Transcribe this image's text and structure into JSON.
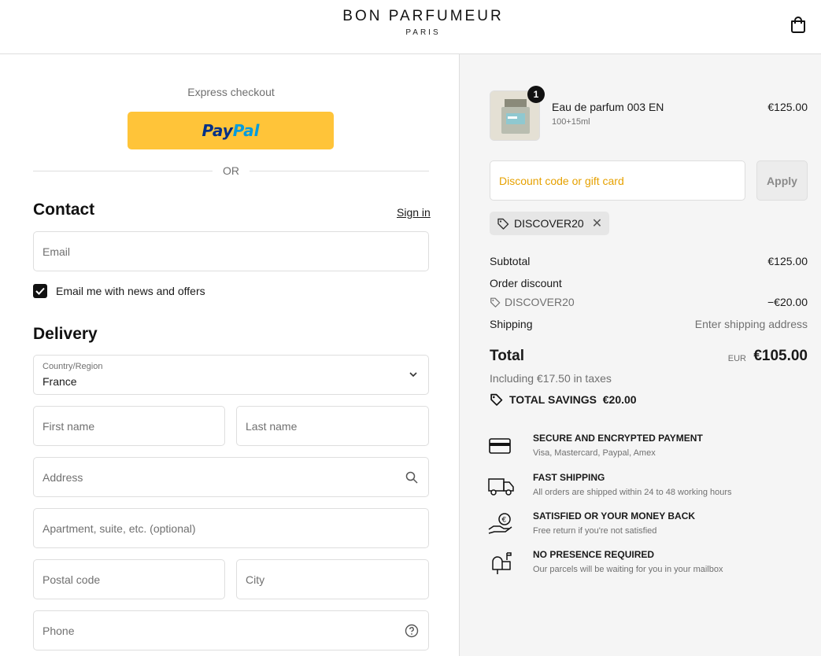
{
  "header": {
    "brand_name": "BON PARFUMEUR",
    "brand_sub": "PARIS",
    "bag_icon": "shopping-bag-icon"
  },
  "express": {
    "label": "Express checkout",
    "paypal_pay": "Pay",
    "paypal_pal": "Pal",
    "or": "OR"
  },
  "contact": {
    "title": "Contact",
    "sign_in": "Sign in",
    "email_placeholder": "Email",
    "newsletter_label": "Email me with news and offers",
    "newsletter_checked": true
  },
  "delivery": {
    "title": "Delivery",
    "country_label": "Country/Region",
    "country_value": "France",
    "first_name_placeholder": "First name",
    "last_name_placeholder": "Last name",
    "address_placeholder": "Address",
    "apartment_placeholder": "Apartment, suite, etc. (optional)",
    "postal_placeholder": "Postal code",
    "city_placeholder": "City",
    "phone_placeholder": "Phone"
  },
  "cart": {
    "items": [
      {
        "quantity": "1",
        "name": "Eau de parfum 003 EN",
        "variant": "100+15ml",
        "price": "€125.00"
      }
    ]
  },
  "discount": {
    "placeholder": "Discount code or gift card",
    "apply_label": "Apply",
    "applied_code": "DISCOVER20"
  },
  "summary": {
    "subtotal_label": "Subtotal",
    "subtotal_value": "€125.00",
    "order_discount_label": "Order discount",
    "discount_code": "DISCOVER20",
    "discount_value": "−€20.00",
    "shipping_label": "Shipping",
    "shipping_value": "Enter shipping address",
    "total_label": "Total",
    "currency": "EUR",
    "total_value": "€105.00",
    "taxes_note": "Including €17.50 in taxes",
    "savings_label": "TOTAL SAVINGS",
    "savings_value": "€20.00"
  },
  "assurances": [
    {
      "icon": "credit-card-icon",
      "title": "SECURE AND ENCRYPTED PAYMENT",
      "desc": "Visa, Mastercard, Paypal, Amex"
    },
    {
      "icon": "delivery-truck-icon",
      "title": "FAST SHIPPING",
      "desc": "All orders are shipped within 24 to 48 working hours"
    },
    {
      "icon": "money-back-icon",
      "title": "SATISFIED OR YOUR MONEY BACK",
      "desc": "Free return if you're not satisfied"
    },
    {
      "icon": "mailbox-icon",
      "title": "NO PRESENCE REQUIRED",
      "desc": "Our parcels will be waiting for you in your mailbox"
    }
  ],
  "colors": {
    "paypal_yellow": "#ffc439",
    "paypal_dark_blue": "#003087",
    "paypal_light_blue": "#009cde",
    "summary_bg": "#f5f5f5",
    "discount_placeholder": "#e6a100",
    "text_primary": "#1a1a1a",
    "text_muted": "#707070"
  }
}
